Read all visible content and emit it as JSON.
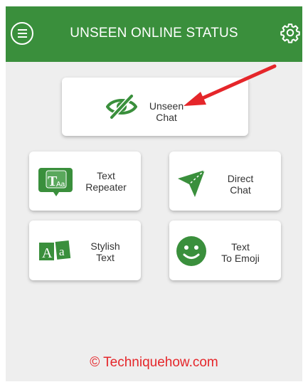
{
  "app": {
    "title": "UNSEEN ONLINE STATUS",
    "brand_color": "#3a8f3c",
    "menu_icon": "hamburger-menu-icon",
    "settings_icon": "gear-icon"
  },
  "cards": {
    "unseen_chat": {
      "label": "Unseen\nChat",
      "icon": "eye-slash-icon"
    },
    "text_repeater": {
      "label": "Text\nRepeater",
      "icon": "text-repeater-icon"
    },
    "direct_chat": {
      "label": "Direct\nChat",
      "icon": "send-arrow-icon"
    },
    "stylish_text": {
      "label": "Stylish\nText",
      "icon": "stylish-text-icon"
    },
    "text_to_emoji": {
      "label": "Text\nTo Emoji",
      "icon": "smiley-icon"
    }
  },
  "footer": {
    "watermark": "© Techniquehow.com",
    "color": "#e5262a"
  }
}
